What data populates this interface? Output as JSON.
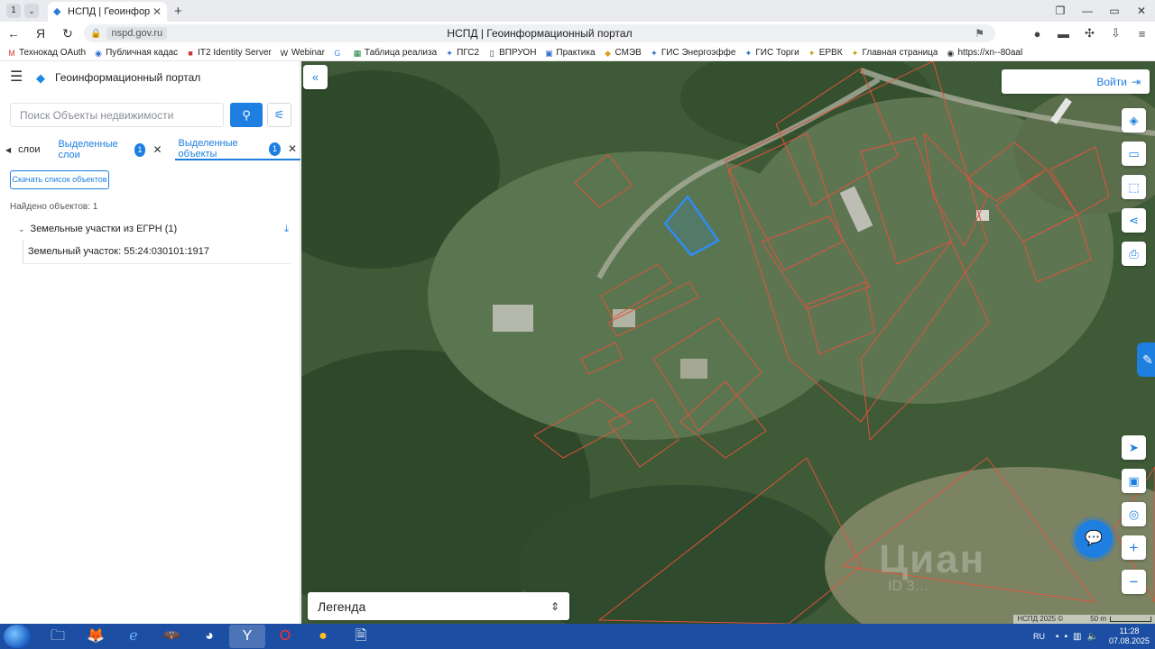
{
  "browser": {
    "tab_number": "1",
    "tab_title": "НСПД | Геоинформаци",
    "page_title": "НСПД | Геоинформационный портал",
    "url": "nspd.gov.ru",
    "bookmarks": [
      "Технокад OAuth",
      "Публичная кадас",
      "IT2 Identity Server",
      "Webinar",
      "Таблица реализа",
      "ПГС2",
      "ВПРУОН",
      "Практика",
      "СМЭВ",
      "ГИС Энергоэффе",
      "ГИС Торги",
      "ЕРВК",
      "Главная страница",
      "https://xn--80aal"
    ]
  },
  "portal": {
    "title": "Геоинформационный портал",
    "search_placeholder": "Поиск Объекты недвижимости",
    "tabs": {
      "layers": "слои",
      "selected_layers": "Выделенные слои",
      "selected_layers_count": "1",
      "selected_objects": "Выделенные объекты",
      "selected_objects_count": "1"
    },
    "download_button": "Скачать список объектов",
    "found_text": "Найдено объектов: 1",
    "group_label": "Земельные участки из ЕГРН (1)",
    "result_item": "Земельный участок: 55:24:030101:1917"
  },
  "map": {
    "login_label": "Войти",
    "legend_label": "Легенда",
    "attribution": "НСПД 2025 ©",
    "scale_label": "50 m",
    "watermark": "Циан",
    "watermark_id": "ID 3…"
  },
  "taskbar": {
    "lang": "RU",
    "time": "11:28",
    "date": "07.08.2025"
  },
  "colors": {
    "accent": "#1e7fe0",
    "parcel_outline": "#e0523c",
    "selected_parcel": "#2f8cf0"
  }
}
